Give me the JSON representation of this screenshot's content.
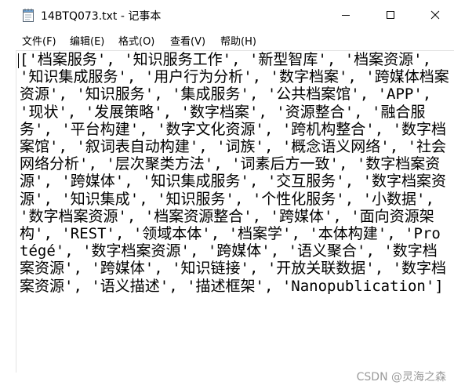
{
  "window": {
    "title": "14BTQ073.txt - 记事本",
    "icon": "notepad-icon"
  },
  "menu": {
    "items": [
      {
        "label": "文件(F)"
      },
      {
        "label": "编辑(E)"
      },
      {
        "label": "格式(O)"
      },
      {
        "label": "查看(V)"
      },
      {
        "label": "帮助(H)"
      }
    ]
  },
  "editor": {
    "content": "['档案服务', '知识服务工作', '新型智库', '档案资源', '知识集成服务', '用户行为分析', '数字档案', '跨媒体档案资源', '知识服务', '集成服务', '公共档案馆', 'APP', '现状', '发展策略', '数字档案', '资源整合', '融合服务', '平台构建', '数字文化资源', '跨机构整合', '数字档案馆', '叙词表自动构建', '词族', '概念语义网络', '社会网络分析', '层次聚类方法', '词素后方一致', '数字档案资源', '跨媒体', '知识集成服务', '交互服务', '数字档案资源', '知识集成', '知识服务', '个性化服务', '小数据', '数字档案资源', '档案资源整合', '跨媒体', '面向资源架构', 'REST', '领域本体', '档案学', '本体构建', 'Protégé', '数字档案资源', '跨媒体', '语义聚合', '数字档案资源', '跨媒体', '知识链接', '开放关联数据', '数字档案资源', '语义描述', '描述框架', 'Nanopublication']"
  },
  "watermark": {
    "text": "CSDN @灵海之森"
  }
}
